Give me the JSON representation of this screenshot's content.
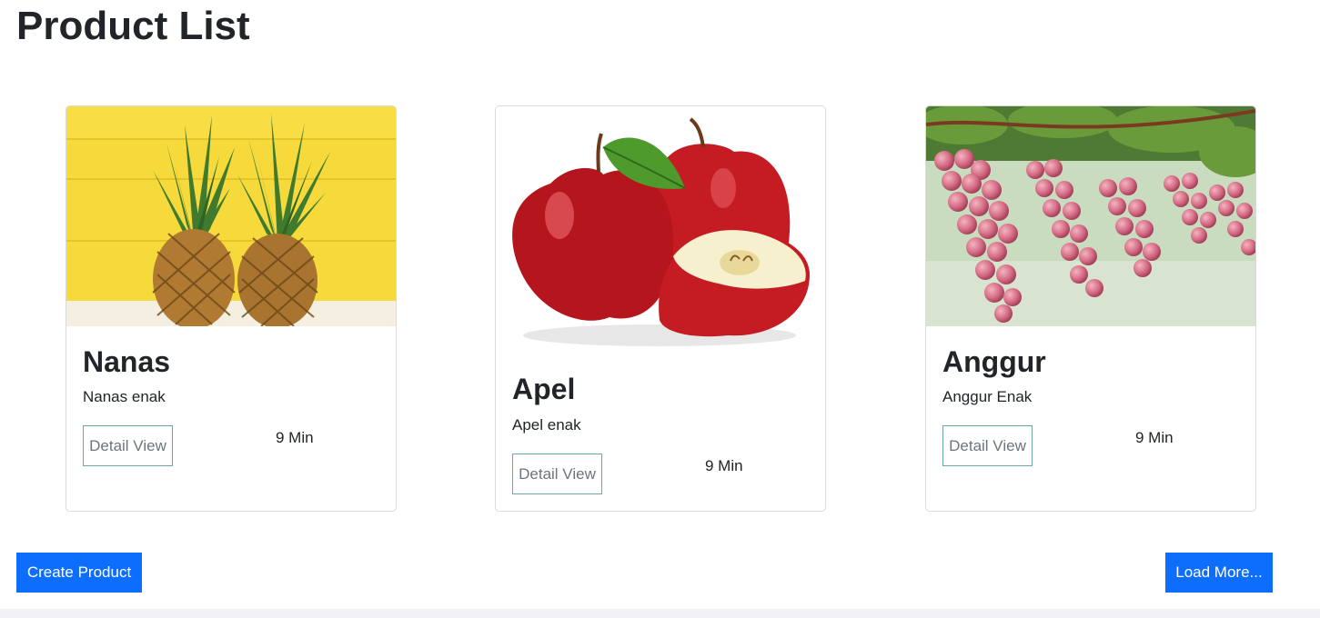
{
  "page": {
    "title": "Product List"
  },
  "products": [
    {
      "name": "Nanas",
      "description": "Nanas enak",
      "detail_label": "Detail View",
      "time": "9 Min",
      "image_icon": "pineapple-image"
    },
    {
      "name": "Apel",
      "description": "Apel enak",
      "detail_label": "Detail View",
      "time": "9 Min",
      "image_icon": "apple-image"
    },
    {
      "name": "Anggur",
      "description": "Anggur Enak",
      "detail_label": "Detail View",
      "time": "9 Min",
      "image_icon": "grapes-image"
    }
  ],
  "actions": {
    "create_label": "Create Product",
    "load_more_label": "Load More..."
  },
  "colors": {
    "primary": "#0d6efd",
    "detail_border": "#6fa7a3",
    "text": "#212529",
    "muted": "#6c757d"
  }
}
